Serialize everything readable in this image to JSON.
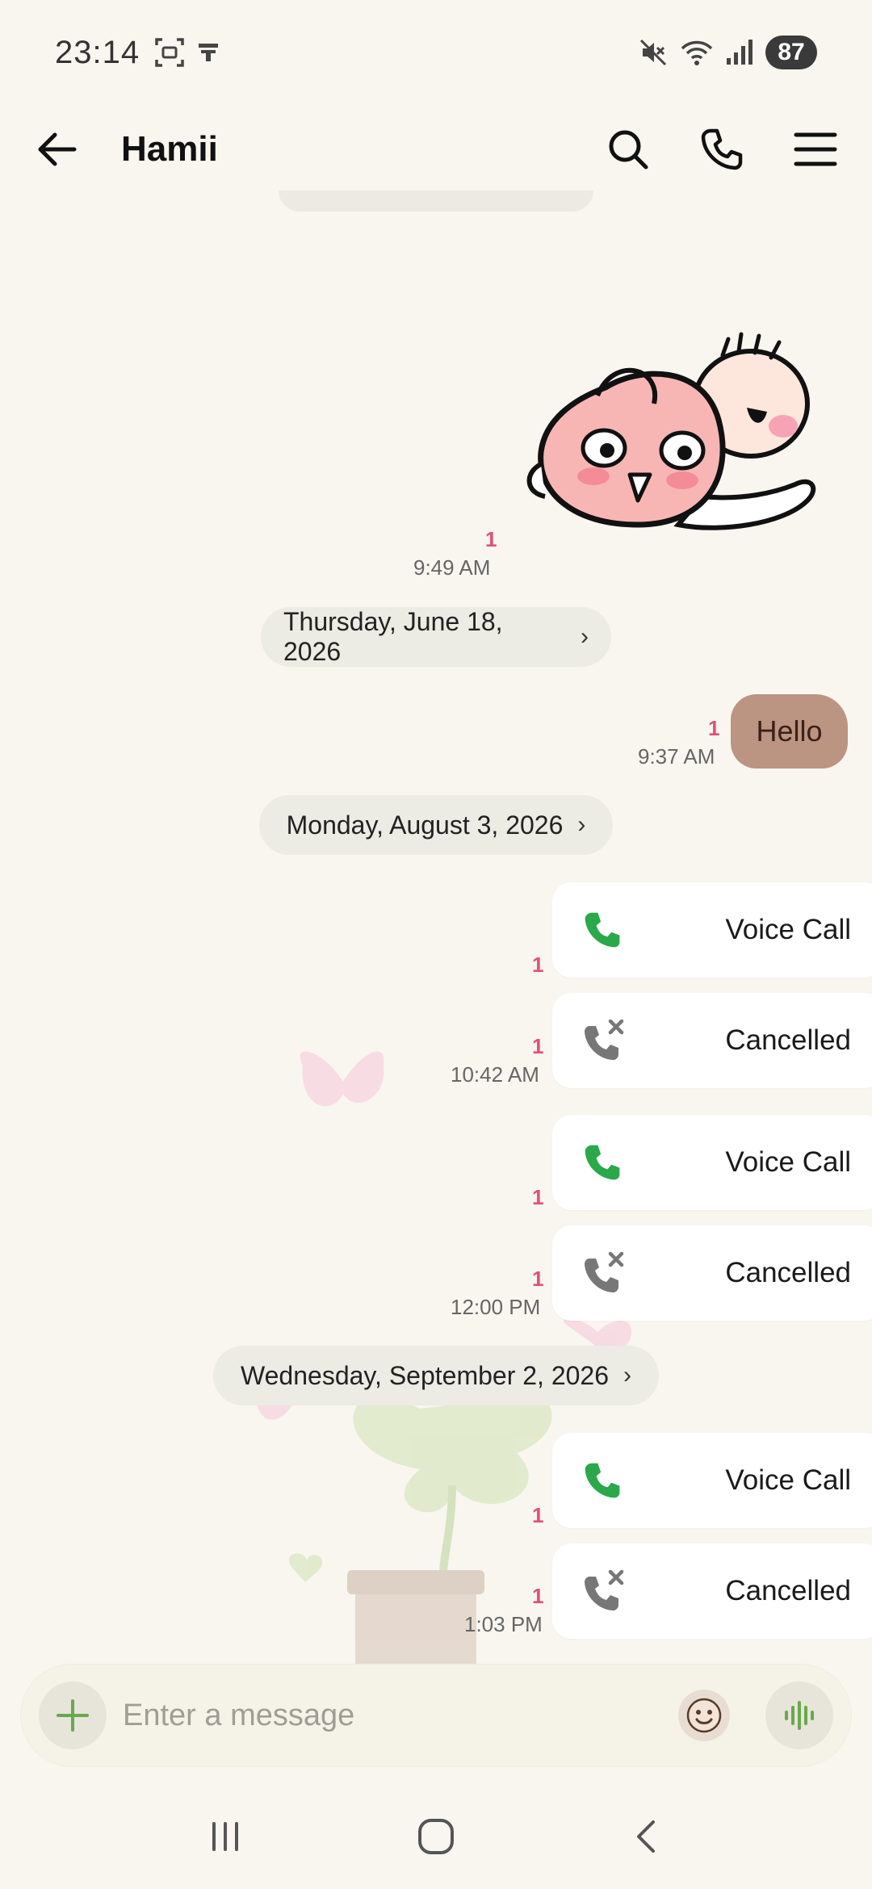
{
  "status_bar": {
    "time": "23:14",
    "battery": "87"
  },
  "header": {
    "title": "Hamii"
  },
  "messages": {
    "sticker": {
      "unread": "1",
      "time": "9:49 AM"
    },
    "date1": "Thursday, June 18, 2026",
    "hello": {
      "text": "Hello",
      "unread": "1",
      "time": "9:37 AM"
    },
    "date2": "Monday, August 3, 2026",
    "calls_aug": [
      {
        "label": "Voice Call",
        "type": "voice",
        "unread": "1"
      },
      {
        "label": "Cancelled",
        "type": "cancelled",
        "unread": "1",
        "time": "10:42 AM"
      },
      {
        "label": "Voice Call",
        "type": "voice",
        "unread": "1"
      },
      {
        "label": "Cancelled",
        "type": "cancelled",
        "unread": "1",
        "time": "12:00 PM"
      }
    ],
    "date3": "Wednesday, September 2, 2026",
    "calls_sep": [
      {
        "label": "Voice Call",
        "type": "voice",
        "unread": "1"
      },
      {
        "label": "Cancelled",
        "type": "cancelled",
        "unread": "1",
        "time": "1:03 PM"
      }
    ]
  },
  "input": {
    "placeholder": "Enter a message"
  },
  "colors": {
    "background": "#f8f6ef",
    "my_bubble": "#bb9482",
    "unread": "#e0507a",
    "call_green": "#2aa84a",
    "cancel_gray": "#777777"
  },
  "icons": {
    "back": "arrow-left",
    "search": "magnifier",
    "call": "phone",
    "menu": "hamburger",
    "add": "plus",
    "emoji": "smile-face",
    "voice": "waveform"
  }
}
